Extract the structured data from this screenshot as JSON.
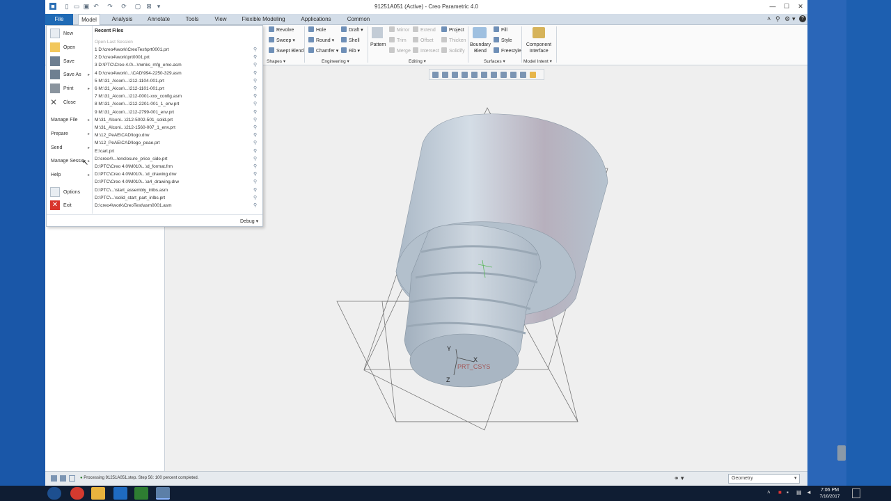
{
  "window": {
    "title": "91251A051 (Active) - Creo Parametric 4.0"
  },
  "tabs": [
    "File",
    "Model",
    "Analysis",
    "Annotate",
    "Tools",
    "View",
    "Flexible Modeling",
    "Applications",
    "Common"
  ],
  "ribbon": {
    "shapes": {
      "revolve": "Revolve",
      "sweep": "Sweep",
      "swept_blend": "Swept Blend",
      "group": "Shapes"
    },
    "engineering": {
      "hole": "Hole",
      "round": "Round",
      "chamfer": "Chamfer",
      "draft": "Draft",
      "shell": "Shell",
      "rib": "Rib",
      "group": "Engineering"
    },
    "editing": {
      "pattern": "Pattern",
      "mirror": "Mirror",
      "trim": "Trim",
      "merge": "Merge",
      "extend": "Extend",
      "offset": "Offset",
      "intersect": "Intersect",
      "project": "Project",
      "thicken": "Thicken",
      "solidify": "Solidify",
      "group": "Editing"
    },
    "surfaces": {
      "boundary_blend": "Boundary Blend",
      "fill": "Fill",
      "style": "Style",
      "freestyle": "Freestyle",
      "group": "Surfaces"
    },
    "model_intent": {
      "component_interface": "Component Interface",
      "group": "Model Intent"
    }
  },
  "file_menu": {
    "items": {
      "new": "New",
      "open": "Open",
      "save": "Save",
      "save_as": "Save As",
      "print": "Print",
      "close": "Close",
      "manage_file": "Manage File",
      "prepare": "Prepare",
      "send": "Send",
      "manage_session": "Manage Session",
      "help": "Help",
      "options": "Options",
      "exit": "Exit"
    },
    "recent_title": "Recent Files",
    "open_last_session": "Open Last Session",
    "recent_files": [
      "1 D:\\creo4\\work\\CreoTest\\prt0001.prt",
      "2 D:\\creo4\\work\\prt0001.prt",
      "3 D:\\PTC\\Creo 4.0\\...\\mmks_mfg_emo.asm",
      "4 D:\\creo4\\work\\...\\CAD\\994-2250-329.asm",
      "5 M:\\31_Alcon\\...\\212-1104-001.prt",
      "6 M:\\31_Alcon\\...\\212-1101-001.prt",
      "7 M:\\31_Alcon\\...\\212-0001-xxx_config.asm",
      "8 M:\\31_Alcon\\...\\212-2201-001_1_env.prt",
      "9 M:\\31_Alcon\\...\\212-2799-001_env.prt",
      "M:\\31_Alcon\\...\\212-5002-501_solid.prt",
      "M:\\31_Alcon\\...\\212-1560-007_1_env.prt",
      "M:\\12_PeAE\\CAD\\logo.drw",
      "M:\\12_PeAE\\CAD\\logo_peae.prt",
      "E:\\cart.prt",
      "D:\\creo4\\...\\enclosure_price_side.prt",
      "D:\\PTC\\Creo 4.0\\M010\\...\\d_format.frm",
      "D:\\PTC\\Creo 4.0\\M010\\...\\d_drawing.drw",
      "D:\\PTC\\Creo 4.0\\M010\\...\\a4_drawing.drw",
      "D:\\PTC\\...\\start_assembly_inlbs.asm",
      "D:\\PTC\\...\\solid_start_part_inlbs.prt",
      "D:\\creo4\\work\\CreoTest\\asm0001.asm"
    ],
    "debug": "Debug"
  },
  "csys": {
    "y": "Y",
    "x": "X",
    "z": "Z",
    "name": "PRT_CSYS"
  },
  "status": {
    "message": "Processing 91251A051.step. Step 56: 100 percent completed.",
    "filter": "Geometry"
  },
  "taskbar": {
    "time": "7:06 PM",
    "date": "7/10/2017"
  }
}
